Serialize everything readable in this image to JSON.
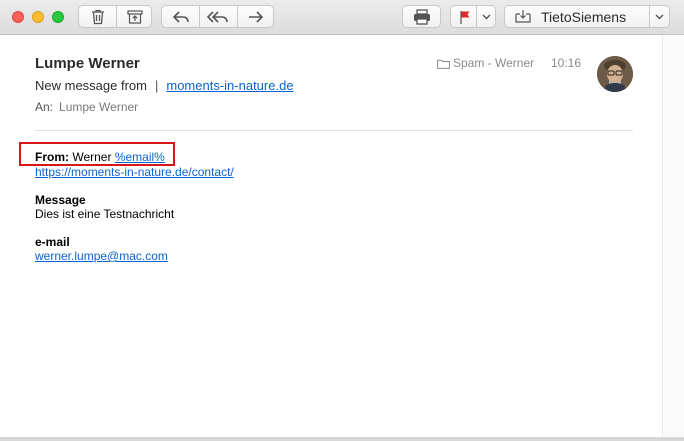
{
  "toolbar": {
    "mailbox": "TietoSiemens",
    "icons": [
      "trash-icon",
      "archive-icon",
      "reply-icon",
      "reply-all-icon",
      "forward-icon",
      "print-icon",
      "flag-icon",
      "chevron-down-icon",
      "move-icon",
      "chevron-down-icon"
    ],
    "flag_color": "#e0252b"
  },
  "header": {
    "sender": "Lumpe Werner",
    "subject_prefix": "New message from",
    "subject_separator": "|",
    "subject_link": "moments-in-nature.de",
    "to_label": "An:",
    "to_name": "Lumpe Werner",
    "folder": "Spam - Werner",
    "time": "10:16"
  },
  "message": {
    "from_label": "From:",
    "from_name": "Werner",
    "from_email_placeholder": "%email%",
    "source_url": "https://moments-in-nature.de/contact/",
    "message_label": "Message",
    "message_text": "Dies ist eine Testnachricht",
    "email_label": "e-mail",
    "email_value": "werner.lumpe@mac.com"
  },
  "annotation": {
    "color": "#d5191b"
  }
}
